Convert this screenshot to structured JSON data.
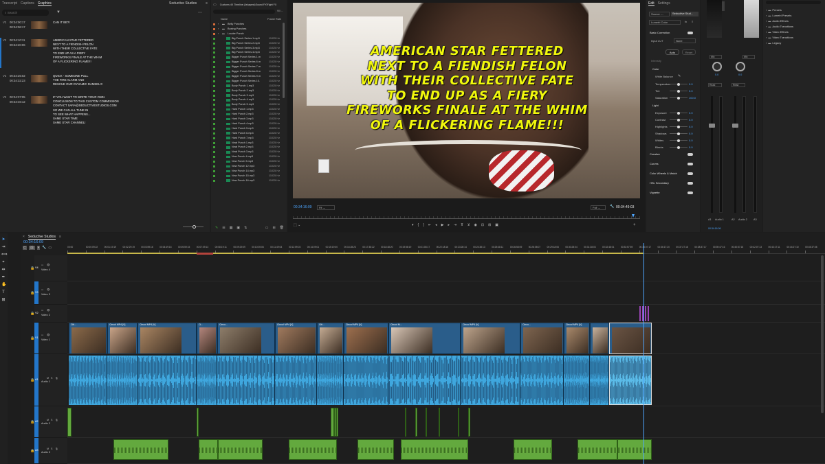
{
  "transcript_panel": {
    "tabs": [
      "Transcript",
      "Captions",
      "Graphics"
    ],
    "active_tab": "Graphics",
    "sequence": "Seductive Studios",
    "search_placeholder": "Search",
    "items": [
      {
        "track": "V2",
        "in": "00:34:00:17",
        "out": "00:34:06:17",
        "text": "CAN IT BE?!"
      },
      {
        "track": "V2",
        "in": "00:34:10:11",
        "out": "00:34:20:06",
        "text": "AMERICAN STAR FETTERED\nNEXT TO A FIENDISH FELON\nWITH THEIR COLLECTIVE FATE\nTO END UP AS A FIERY\nFIREWORKS FINALE AT THE WHIM\nOF A FLICKERING FLAME!!!"
      },
      {
        "track": "V2",
        "in": "00:34:25:02",
        "out": "00:34:32:23",
        "text": "QUICK - SOMEONE PULL\nTHE FIRE ALARM AND\nRESCUE OUR DYNAMIC DAMSEL!!!"
      },
      {
        "track": "V2",
        "in": "00:34:37:05",
        "out": "00:34:46:12",
        "text": "IF YOU WANT TO WRITE YOUR OWN\nCONCLUSION TO THIS CUSTOM COMMISSION\nCONTACT SARA@SEDUCTIVESTUDIOS.COM\nSO WE CAN ALL TUNE IN\nTO SEE WHAT HAPPENS...\nSAME STAR TIME\nSAME STAR CHANNEL!"
      }
    ]
  },
  "project_panel": {
    "path": "Customs 4K Timeline (4shapes)\\Sound FX\\Fight FX",
    "count": "90 i...",
    "col_name": "Name",
    "col_rate": "Frame Rate",
    "folders": [
      "Belly Punches",
      "Boxing Punches",
      "Louder Punch"
    ],
    "items": [
      [
        "Big Punch Series 1.mp3",
        "11025 Hz"
      ],
      [
        "Big Punch Series 2.mp3",
        "11025 Hz"
      ],
      [
        "Big Punch Series 3.mp3",
        "11025 Hz"
      ],
      [
        "Big Punch Series 4.mp3",
        "11025 Hz"
      ],
      [
        "Bigger Punch Series 1.m",
        "11025 Hz"
      ],
      [
        "Bigger Punch Series 6.m",
        "11025 Hz"
      ],
      [
        "Bigger Punch Series 7.m",
        "11025 Hz"
      ],
      [
        "Bigger Punch Series 8.m",
        "11025 Hz"
      ],
      [
        "Bigger Punch Series 9.m",
        "11025 Hz"
      ],
      [
        "Bigger Punch Series 10.",
        "11025 Hz"
      ],
      [
        "Body Punch 1.mp3",
        "11025 Hz"
      ],
      [
        "Body Punch 2.mp3",
        "11025 Hz"
      ],
      [
        "Body Punch 3.mp3",
        "11025 Hz"
      ],
      [
        "Body Punch 4.mp3",
        "11025 Hz"
      ],
      [
        "Body Punch 5.mp3",
        "11025 Hz"
      ],
      [
        "Hard Punch 1.mp3",
        "11025 Hz"
      ],
      [
        "Hard Punch 2.mp3",
        "11025 Hz"
      ],
      [
        "Hard Punch 3.mp3",
        "11025 Hz"
      ],
      [
        "Hard Punch 4.mp3",
        "11025 Hz"
      ],
      [
        "Hard Punch 5.mp3",
        "11025 Hz"
      ],
      [
        "Hard Punch 6.mp3",
        "11025 Hz"
      ],
      [
        "Hard Punch 7.mp3",
        "11025 Hz"
      ],
      [
        "Neat Punch 1.mp3",
        "11025 Hz"
      ],
      [
        "Neat Punch 2.mp3",
        "11025 Hz"
      ],
      [
        "Neat Punch 3.mp3",
        "11025 Hz"
      ],
      [
        "New Punch 4.mp3",
        "11025 Hz"
      ],
      [
        "New Punch 5.mp3",
        "11025 Hz"
      ],
      [
        "New Punch 12.mp3",
        "11025 Hz"
      ],
      [
        "New Punch 14.mp3",
        "11025 Hz"
      ],
      [
        "New Punch 15.mp3",
        "11025 Hz"
      ],
      [
        "New Punch 16.mp3",
        "11025 Hz"
      ]
    ]
  },
  "program_monitor": {
    "caption": [
      "AMERICAN STAR FETTERED",
      "NEXT TO A FIENDISH FELON",
      "WITH THEIR COLLECTIVE FATE",
      "TO END UP AS A FIERY",
      "FIREWORKS FINALE AT THE WHIM",
      "OF A FLICKERING FLAME!!!"
    ],
    "current_time": "00:34:16:09",
    "fit": "Fit",
    "quality": "Full",
    "duration": "00:34:49:03"
  },
  "lumetri": {
    "tabs": [
      "Edit",
      "Settings"
    ],
    "source": "Source -...",
    "seq": "Seductive Stud...",
    "effect": "Lumetri Color",
    "basic_correction": "Basic Correction",
    "input_lut_label": "Input LUT",
    "input_lut": "None",
    "auto": "Auto",
    "reset": "Reset",
    "intensity": "Intensity",
    "color": "Color",
    "white_balance": "White Balance",
    "sliders_color": [
      [
        "Temperature",
        "0.0"
      ],
      [
        "Tint",
        "0.0"
      ],
      [
        "Saturation",
        "100.0"
      ]
    ],
    "light": "Light",
    "sliders_light": [
      [
        "Exposure",
        "0.0"
      ],
      [
        "Contrast",
        "0.0"
      ],
      [
        "Highlights",
        "0.0"
      ],
      [
        "Shadows",
        "0.0"
      ],
      [
        "Whites",
        "0.0"
      ],
      [
        "Blacks",
        "0.0"
      ]
    ],
    "sections": [
      "Creative",
      "Curves",
      "Color Wheels & Match",
      "HSL Secondary",
      "Vignette"
    ]
  },
  "audio_mixer": {
    "tracks": [
      "Audio 1",
      "Audio 2"
    ],
    "routing": [
      "Mix",
      "Mix"
    ],
    "values": [
      "0.0",
      "0.0"
    ],
    "read": [
      "Read",
      "Read"
    ],
    "labels": [
      "A1",
      "A2",
      "A3"
    ],
    "timecode": "00:34:16:09",
    "track_label": "00:34:16:09 Vid..."
  },
  "effects": {
    "items": [
      "Presets",
      "Lumetri Presets",
      "Audio Effects",
      "Audio Transitions",
      "Video Effects",
      "Video Transitions",
      "Legacy"
    ]
  },
  "timeline": {
    "sequence": "Seductive Studios",
    "timecode": "00:34:16:09",
    "ruler": [
      "00:00",
      "00:00:09:22",
      "00:01:19:19",
      "00:02:29:19",
      "00:03:59:16",
      "00:04:49:16",
      "00:05:59:15",
      "00:07:09:13",
      "00:08:19:11",
      "00:09:29:09",
      "00:10:39:06",
      "00:11:49:04",
      "00:12:59:03",
      "00:14:09:01",
      "00:15:19:00",
      "00:16:28:23",
      "00:17:38:22",
      "00:18:48:20",
      "00:19:58:19",
      "00:21:08:17",
      "00:22:18:16",
      "00:23:28:14",
      "00:24:38:13",
      "00:25:48:11",
      "00:26:58:09",
      "00:28:08:07",
      "00:29:18:06",
      "00:30:28:04",
      "00:31:38:03",
      "00:32:48:01",
      "00:33:57:59",
      "00:35:07:17",
      "00:36:17:20",
      "00:37:27:18",
      "00:38:37:17",
      "00:39:47:16",
      "00:40:57:15",
      "00:42:07:13",
      "00:43:17:11",
      "00:44:27:10",
      "00:45:37:08"
    ],
    "video_tracks": [
      [
        "V4",
        "Video 4"
      ],
      [
        "V3",
        "Video 3"
      ],
      [
        "V2",
        "Video 2"
      ],
      [
        "V1",
        "Video 1"
      ]
    ],
    "audio_tracks": [
      [
        "A1",
        "Audio 1"
      ],
      [
        "A2",
        "Audio 2"
      ],
      [
        "A3",
        "Audio 3"
      ]
    ],
    "v1_clip_labels": [
      "Citi...",
      "Cinco! MP4 [V]",
      "Cinco! MP4 [V]",
      "Ci...",
      "Cinco...",
      "Cinco! MP4 [V]",
      "Citi...",
      "Cinco! MP4 [V]",
      "Cinco! M...",
      "Cinco! MP4 [V]",
      "Cinco...",
      "Cinco! MP4 [V]"
    ],
    "track_letters": {
      "mute": "M",
      "solo": "S"
    }
  },
  "colors": {
    "caption": "#f1f70c",
    "clip_video": "#2a5d8a",
    "clip_audio": "#3fa7de",
    "clip_green": "#63a93e",
    "playhead": "#4ea6ff",
    "accent": "#2376c9"
  }
}
